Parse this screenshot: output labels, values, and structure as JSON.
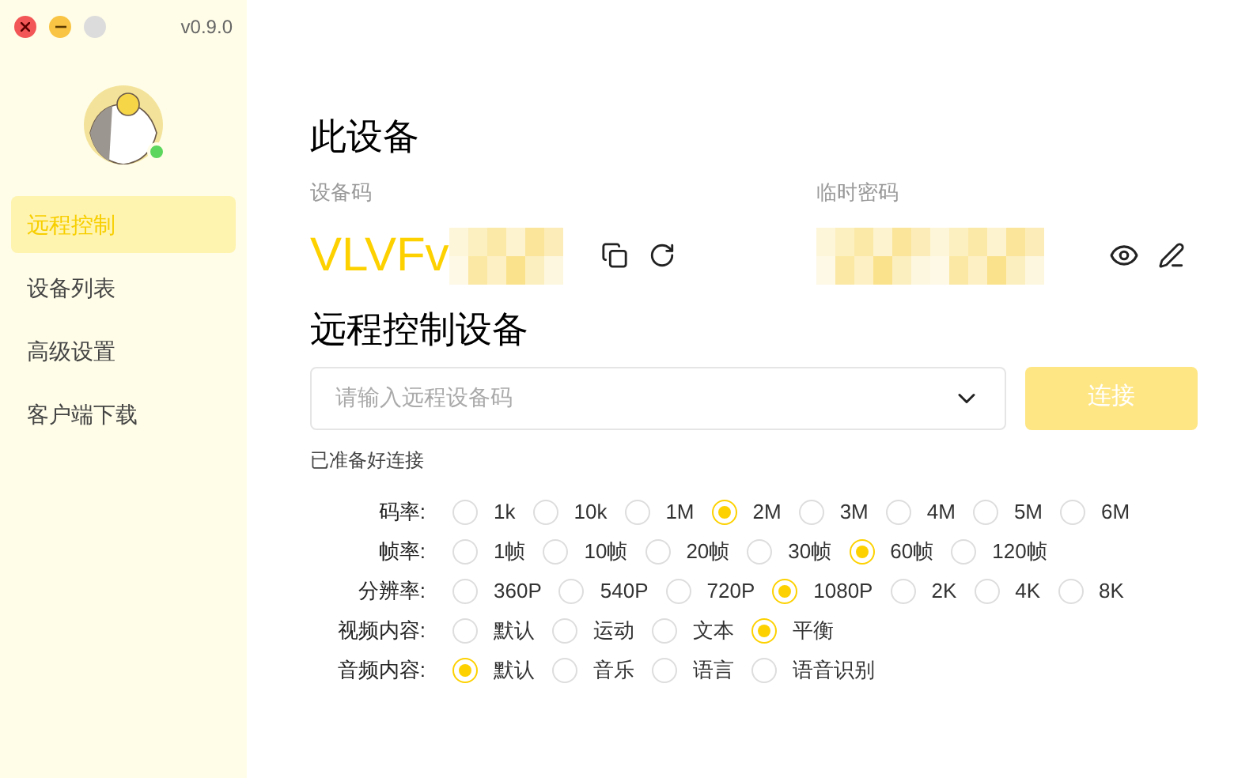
{
  "window": {
    "version": "v0.9.0"
  },
  "sidebar": {
    "online": true,
    "items": [
      {
        "label": "远程控制",
        "selected": true
      },
      {
        "label": "设备列表",
        "selected": false
      },
      {
        "label": "高级设置",
        "selected": false
      },
      {
        "label": "客户端下载",
        "selected": false
      }
    ]
  },
  "this_device": {
    "title": "此设备",
    "device_code": {
      "label": "设备码",
      "value": "VLVFv"
    },
    "temp_password": {
      "label": "临时密码"
    }
  },
  "remote": {
    "title": "远程控制设备",
    "input": {
      "placeholder": "请输入远程设备码"
    },
    "connect_button": {
      "label": "连接",
      "disabled": true
    },
    "status": "已准备好连接"
  },
  "settings": [
    {
      "label": "码率:",
      "options": [
        {
          "label": "1k",
          "selected": false
        },
        {
          "label": "10k",
          "selected": false
        },
        {
          "label": "1M",
          "selected": false
        },
        {
          "label": "2M",
          "selected": true
        },
        {
          "label": "3M",
          "selected": false
        },
        {
          "label": "4M",
          "selected": false
        },
        {
          "label": "5M",
          "selected": false
        },
        {
          "label": "6M",
          "selected": false
        }
      ]
    },
    {
      "label": "帧率:",
      "options": [
        {
          "label": "1帧",
          "selected": false
        },
        {
          "label": "10帧",
          "selected": false
        },
        {
          "label": "20帧",
          "selected": false
        },
        {
          "label": "30帧",
          "selected": false
        },
        {
          "label": "60帧",
          "selected": true
        },
        {
          "label": "120帧",
          "selected": false
        }
      ]
    },
    {
      "label": "分辨率:",
      "options": [
        {
          "label": "360P",
          "selected": false
        },
        {
          "label": "540P",
          "selected": false
        },
        {
          "label": "720P",
          "selected": false
        },
        {
          "label": "1080P",
          "selected": true
        },
        {
          "label": "2K",
          "selected": false
        },
        {
          "label": "4K",
          "selected": false
        },
        {
          "label": "8K",
          "selected": false
        }
      ]
    },
    {
      "label": "视频内容:",
      "options": [
        {
          "label": "默认",
          "selected": false
        },
        {
          "label": "运动",
          "selected": false
        },
        {
          "label": "文本",
          "selected": false
        },
        {
          "label": "平衡",
          "selected": true
        }
      ]
    },
    {
      "label": "音频内容:",
      "options": [
        {
          "label": "默认",
          "selected": true
        },
        {
          "label": "音乐",
          "selected": false
        },
        {
          "label": "语言",
          "selected": false
        },
        {
          "label": "语音识别",
          "selected": false
        }
      ]
    }
  ]
}
